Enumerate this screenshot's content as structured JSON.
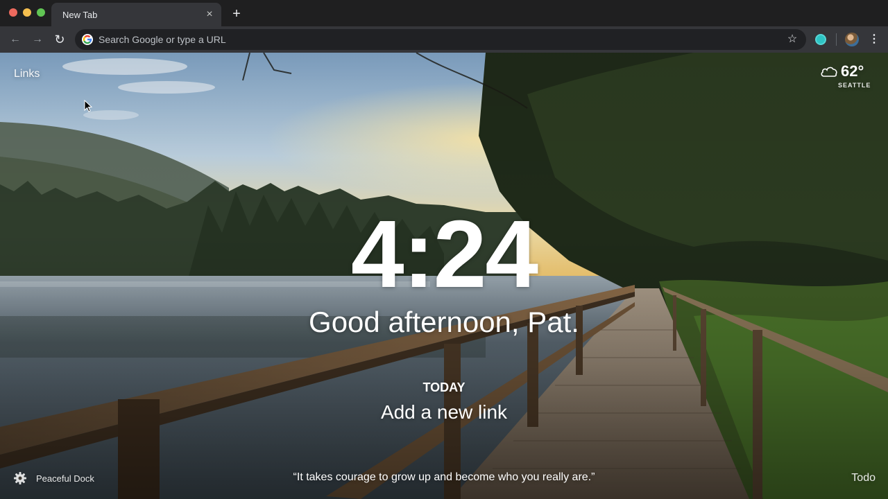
{
  "browser": {
    "tab_title": "New Tab",
    "tab_close_glyph": "×",
    "new_tab_glyph": "+",
    "back_glyph": "←",
    "forward_glyph": "→",
    "reload_glyph": "↻",
    "omnibox_placeholder": "Search Google or type a URL",
    "bookmark_glyph": "☆",
    "menu_glyph": "⋮"
  },
  "dashboard": {
    "links_label": "Links",
    "weather": {
      "temperature": "62°",
      "location": "SEATTLE",
      "icon": "cloud-icon"
    },
    "clock": "4:24",
    "greeting": "Good afternoon, Pat.",
    "focus_heading": "TODAY",
    "focus_text": "Add a new link",
    "photo_title": "Peaceful Dock",
    "quote": "“It takes courage to grow up and become who you really are.”",
    "todo_label": "Todo"
  },
  "colors": {
    "tabstrip": "#1f1f20",
    "toolbar": "#35363a",
    "omnibox": "#202124",
    "extension": "#2ec4c4"
  }
}
